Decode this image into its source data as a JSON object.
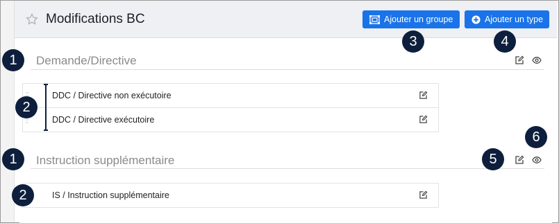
{
  "header": {
    "title": "Modifications BC",
    "add_group_label": "Ajouter un groupe",
    "add_type_label": "Ajouter un type"
  },
  "sections": [
    {
      "title": "Demande/Directive",
      "items": [
        {
          "label": "DDC / Directive non exécutoire"
        },
        {
          "label": "DDC / Directive exécutoire"
        }
      ]
    },
    {
      "title": "Instruction supplémentaire",
      "items": [
        {
          "label": "IS / Instruction supplémentaire"
        }
      ]
    }
  ],
  "callouts": [
    "1",
    "2",
    "3",
    "4",
    "1",
    "2",
    "5",
    "6"
  ],
  "colors": {
    "primary_button": "#1a73e8",
    "callout_badge": "#0d1f3c",
    "header_bg": "#eef0f4",
    "section_title": "#8a8a8a"
  },
  "icons": [
    "star-icon",
    "group-icon",
    "plus-circle-icon",
    "edit-icon",
    "eye-icon",
    "drag-handle-icon"
  ]
}
